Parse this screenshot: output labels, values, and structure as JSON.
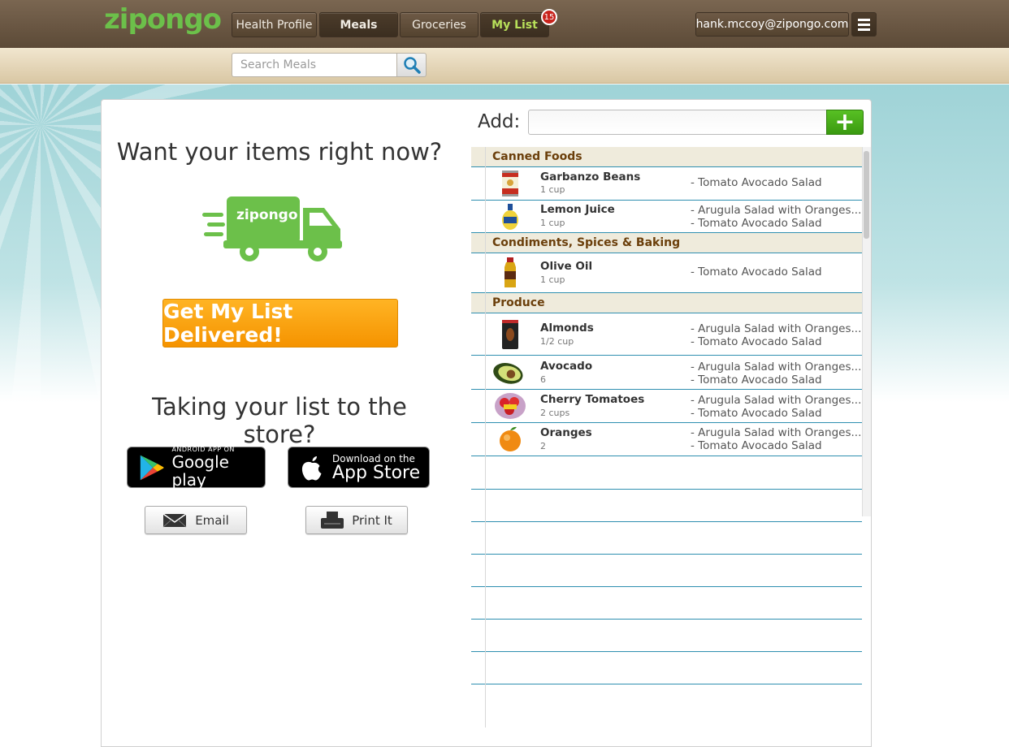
{
  "header": {
    "logo": "zipongo",
    "tabs": [
      {
        "label": "Health Profile"
      },
      {
        "label": "Meals"
      },
      {
        "label": "Groceries"
      },
      {
        "label": "My List"
      }
    ],
    "list_badge_count": "15",
    "user_email": "hank.mccoy@zipongo.com"
  },
  "search": {
    "placeholder": "Search Meals"
  },
  "promo": {
    "title": "Want your items right now?",
    "truck_logo_text": "zipongo",
    "deliver_button": "Get My List Delivered!",
    "store_title": "Taking your list to the store?",
    "google_play_small": "ANDROID APP ON",
    "google_play_big": "Google play",
    "app_store_small": "Download on the",
    "app_store_big": "App Store",
    "email_button": "Email",
    "print_button": "Print It"
  },
  "add": {
    "label": "Add:",
    "value": "",
    "button": "+"
  },
  "list": {
    "categories": [
      {
        "name": "Canned Foods",
        "items": [
          {
            "name": "Garbanzo Beans",
            "qty": "1 cup",
            "meals": [
              "- Tomato Avocado Salad"
            ]
          },
          {
            "name": "Lemon Juice",
            "qty": "1 cup",
            "meals": [
              "- Arugula Salad with Oranges...",
              "- Tomato Avocado Salad"
            ]
          }
        ]
      },
      {
        "name": "Condiments, Spices & Baking",
        "items": [
          {
            "name": "Olive Oil",
            "qty": "1 cup",
            "meals": [
              "- Tomato Avocado Salad"
            ]
          }
        ]
      },
      {
        "name": "Produce",
        "items": [
          {
            "name": "Almonds",
            "qty": "1/2 cup",
            "meals": [
              "- Arugula Salad with Oranges...",
              "- Tomato Avocado Salad"
            ]
          },
          {
            "name": "Avocado",
            "qty": "6",
            "meals": [
              "- Arugula Salad with Oranges...",
              "- Tomato Avocado Salad"
            ]
          },
          {
            "name": "Cherry Tomatoes",
            "qty": "2 cups",
            "meals": [
              "- Arugula Salad with Oranges...",
              "- Tomato Avocado Salad"
            ]
          },
          {
            "name": "Oranges",
            "qty": "2",
            "meals": [
              "- Arugula Salad with Oranges...",
              "- Tomato Avocado Salad"
            ]
          }
        ]
      }
    ]
  },
  "colors": {
    "brand_green": "#6cc04a",
    "header_brown": "#5c4a37",
    "category_text": "#6b3f0b",
    "rule_blue": "#2f8fb0",
    "deliver_orange": "#f59300",
    "badge_red": "#c8231c"
  },
  "icons": {
    "search": "magnifier-icon",
    "menu": "hamburger-icon",
    "truck": "delivery-truck-icon",
    "email": "envelope-icon",
    "print": "printer-icon",
    "add": "plus-icon"
  }
}
